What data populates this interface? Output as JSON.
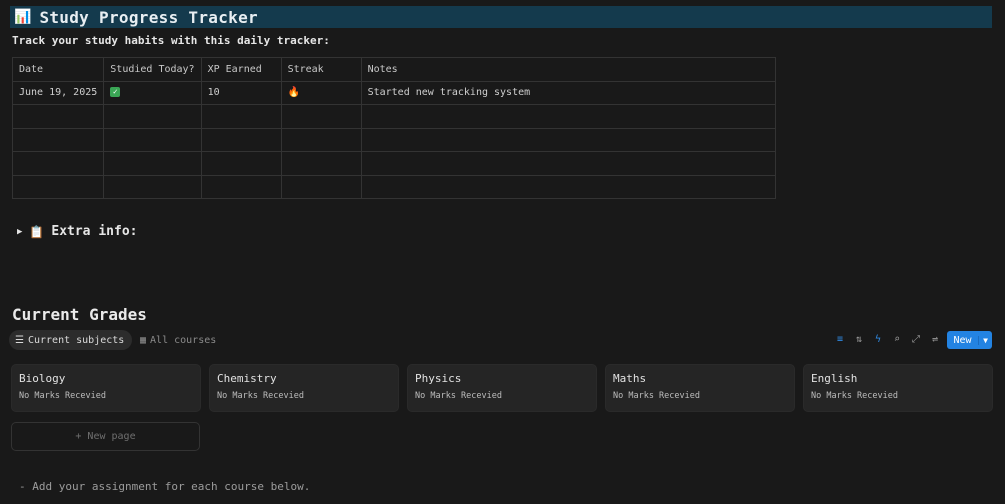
{
  "header": {
    "icon": "bar-chart-icon",
    "title": "Study Progress Tracker"
  },
  "subtitle": "Track your study habits with this daily tracker:",
  "tracker": {
    "columns": [
      "Date",
      "Studied Today?",
      "XP Earned",
      "Streak",
      "Notes"
    ],
    "rows": [
      {
        "date": "June 19, 2025",
        "studied": "checkmark-icon",
        "xp": "10",
        "streak": "fire-icon",
        "notes": "Started new tracking system"
      }
    ],
    "empty_rows": 4
  },
  "toggle": {
    "label": "Extra info:",
    "icon": "clipboard-icon"
  },
  "grades": {
    "title": "Current Grades",
    "tabs": [
      {
        "label": "Current subjects",
        "icon": "list-icon",
        "active": true
      },
      {
        "label": "All courses",
        "icon": "grid-icon",
        "active": false
      }
    ],
    "new_label": "New",
    "courses": [
      {
        "name": "Biology",
        "status": "No Marks Recevied"
      },
      {
        "name": "Chemistry",
        "status": "No Marks Recevied"
      },
      {
        "name": "Physics",
        "status": "No Marks Recevied"
      },
      {
        "name": "Maths",
        "status": "No Marks Recevied"
      },
      {
        "name": "English",
        "status": "No Marks Recevied"
      }
    ],
    "new_page_label": "+ New page"
  },
  "footer_note": "- Add your assignment for each course below.",
  "colors": {
    "banner": "#143a4d",
    "accent": "#2383e2",
    "background": "#191919"
  }
}
